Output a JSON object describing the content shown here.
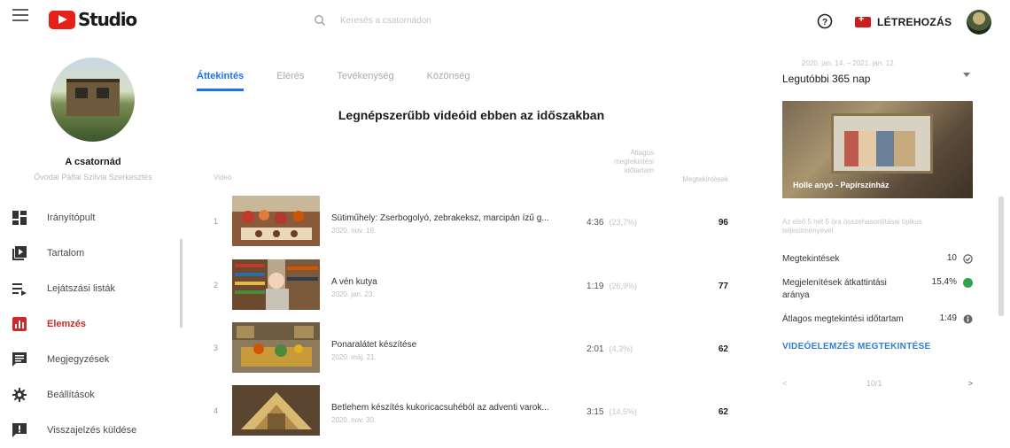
{
  "topbar": {
    "brand": "Studio",
    "search_placeholder": "Keresés a csatornádon",
    "create_label": "LÉTREHOZÁS"
  },
  "sidebar": {
    "channel_name": "A csatornád",
    "channel_sub": "Óvodai Pálfai Szilvia Szerkesztés",
    "items": [
      {
        "label": "Irányítópult",
        "icon": "dashboard-icon"
      },
      {
        "label": "Tartalom",
        "icon": "content-icon"
      },
      {
        "label": "Lejátszási listák",
        "icon": "playlist-icon"
      },
      {
        "label": "Elemzés",
        "icon": "analytics-icon",
        "active": true
      },
      {
        "label": "Megjegyzések",
        "icon": "comments-icon"
      },
      {
        "label": "Beállítások",
        "icon": "settings-icon"
      },
      {
        "label": "Visszajelzés küldése",
        "icon": "feedback-icon"
      }
    ]
  },
  "main": {
    "tabs": [
      "Áttekintés",
      "Elérés",
      "Tevékenység",
      "Közönség"
    ],
    "section_title": "Legnépszerűbb videóid ebben az időszakban",
    "table": {
      "header_video": "Videó",
      "header_duration": "Átlagos megtekintési időtartam",
      "header_views": "Megtekintések",
      "rows": [
        {
          "rank": "1",
          "title": "Sütiműhely: Zserbogolyó, zebrakeksz, marcipán ízű g...",
          "date": "2020. nov. 19.",
          "duration": "4:36",
          "percent": "(23,7%)",
          "views": "96"
        },
        {
          "rank": "2",
          "title": "A vén kutya",
          "date": "2020. jan. 23.",
          "duration": "1:19",
          "percent": "(26,9%)",
          "views": "77"
        },
        {
          "rank": "3",
          "title": "Ponaralátet készítése",
          "date": "2020. máj. 21.",
          "duration": "2:01",
          "percent": "(4,3%)",
          "views": "62"
        },
        {
          "rank": "4",
          "title": "Betlehem készítés kukoricacsuhéból az adventi varok...",
          "date": "2020. nov. 30.",
          "duration": "3:15",
          "percent": "(14,5%)",
          "views": "62"
        }
      ]
    }
  },
  "panel": {
    "range_sub": "2020. jan. 14. – 2021. jan. 12.",
    "range_main": "Legutóbbi 365 nap",
    "featured_caption": "Holle anyó - Papírszínház",
    "stat_note": "Az első 5 hét 5 óra összehasonlításai típikus teljesítményével",
    "stats": [
      {
        "name": "Megtekintések",
        "value": "10",
        "indicator": "check-circle-icon"
      },
      {
        "name": "Megjelenítések átkattintási aránya",
        "value": "15,4%",
        "indicator": "green-dot-icon"
      },
      {
        "name": "Átlagos megtekintési időtartam",
        "value": "1:49",
        "indicator": "info-dot-icon"
      }
    ],
    "analytics_link": "VIDEÓELEMZÉS MEGTEKINTÉSE",
    "pager_count": "10/1"
  },
  "colors": {
    "accent_blue": "#1a73e8",
    "brand_red": "#e62117",
    "active_nav": "#cc2a2a",
    "status_green": "#2ea44f"
  }
}
